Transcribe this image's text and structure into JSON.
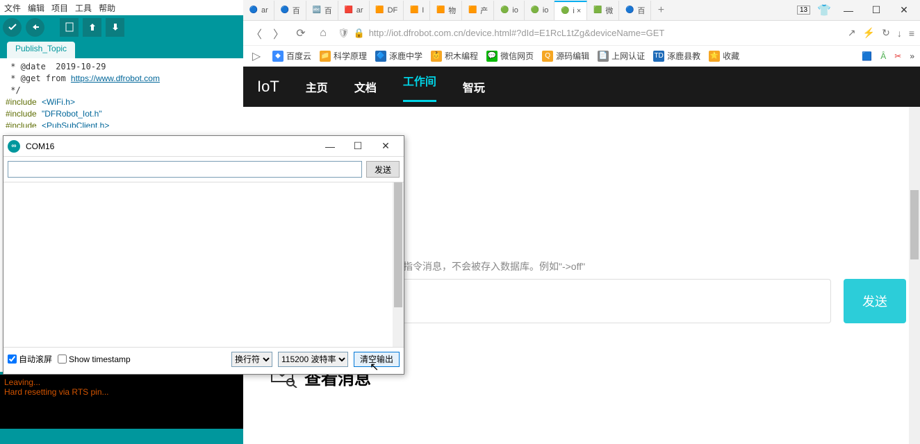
{
  "ide": {
    "menu": [
      "文件",
      "编辑",
      "项目",
      "工具",
      "帮助"
    ],
    "tab": "Publish_Topic",
    "code_html": " * @date  2019-10-29\n * @get from <span class='c-link'>https://www.dfrobot.com</span>\n */\n<span class='c-preproc'>#include</span> <span class='c-string'>&lt;WiFi.h&gt;</span>\n<span class='c-preproc'>#include</span> <span class='c-string'>\"DFRobot_Iot.h\"</span>\n<span class='c-preproc'>#include</span> <span class='c-string'>&lt;PubSubClient.h&gt;</span>",
    "console_line1": "Leaving...",
    "console_line2": "Hard resetting via RTS pin..."
  },
  "serial": {
    "title": "COM16",
    "send": "发送",
    "autoscroll": "自动滚屏",
    "timestamp": "Show timestamp",
    "line_ending": "换行符",
    "baud": "115200 波特率",
    "clear": "清空输出"
  },
  "browser": {
    "tabs": [
      {
        "icon": "🔵",
        "label": "ar"
      },
      {
        "icon": "🔵",
        "label": "百"
      },
      {
        "icon": "🔤",
        "label": "百"
      },
      {
        "icon": "🟥",
        "label": "ar"
      },
      {
        "icon": "🟧",
        "label": "DF"
      },
      {
        "icon": "🟧",
        "label": "I"
      },
      {
        "icon": "🟧",
        "label": "物"
      },
      {
        "icon": "🟧",
        "label": "产"
      },
      {
        "icon": "🟢",
        "label": "io"
      },
      {
        "icon": "🟢",
        "label": "io"
      },
      {
        "icon": "🟢",
        "label": "i ×",
        "active": true
      },
      {
        "icon": "🟩",
        "label": "微"
      },
      {
        "icon": "🔵",
        "label": "百"
      }
    ],
    "badge": "13",
    "url": "http://iot.dfrobot.com.cn/device.html#?dId=E1RcL1tZg&deviceName=GET",
    "bookmarks": [
      {
        "icon": "⭐",
        "label": "收藏",
        "color": "#f5a623"
      },
      {
        "icon": "TD",
        "label": "涿鹿县教",
        "color": "#1e6bb8"
      },
      {
        "icon": "📄",
        "label": "上网认证",
        "color": "#888"
      },
      {
        "icon": "Q",
        "label": "源码编辑",
        "color": "#f5a623"
      },
      {
        "icon": "💬",
        "label": "微信网页",
        "color": "#09bb07"
      },
      {
        "icon": "👶",
        "label": "积木编程",
        "color": "#f5a623"
      },
      {
        "icon": "🔷",
        "label": "涿鹿中学",
        "color": "#1e6bb8"
      },
      {
        "icon": "📁",
        "label": "科学原理",
        "color": "#f5a623"
      },
      {
        "icon": "◆",
        "label": "百度云",
        "color": "#3b8cff"
      }
    ]
  },
  "page": {
    "brand": "IoT",
    "nav": [
      {
        "label": "主页"
      },
      {
        "label": "文档"
      },
      {
        "label": "工作间",
        "active": true
      },
      {
        "label": "智玩"
      }
    ],
    "hint": "指令消息，不会被存入数据库。例如\"->off\"",
    "send": "发送",
    "section": "查看消息"
  }
}
